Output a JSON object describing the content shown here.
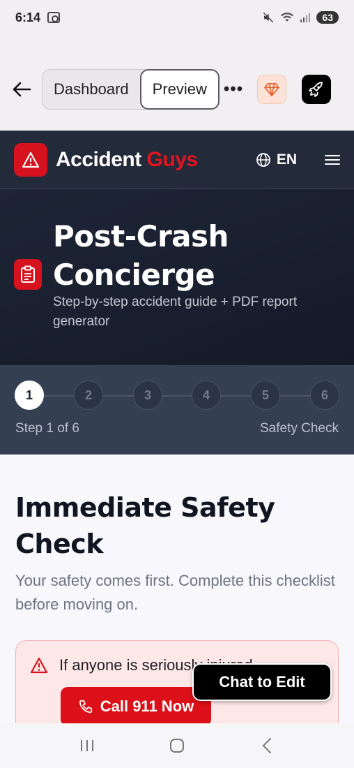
{
  "status_bar": {
    "time": "6:14",
    "battery": "63"
  },
  "browser": {
    "tabs": [
      {
        "label": "Dashboard",
        "active": false
      },
      {
        "label": "Preview",
        "active": true
      }
    ],
    "more_label": "•••"
  },
  "site": {
    "brand_main": "Accident",
    "brand_accent": "Guys",
    "language": "EN"
  },
  "hero": {
    "title": "Post-Crash Concierge",
    "subtitle": "Step-by-step accident guide + PDF report generator"
  },
  "stepper": {
    "steps": [
      "1",
      "2",
      "3",
      "4",
      "5",
      "6"
    ],
    "current": 1,
    "progress_text": "Step 1 of 6",
    "current_label": "Safety Check"
  },
  "section": {
    "title": "Immediate Safety Check",
    "subtitle": "Your safety comes first. Complete this checklist before moving on."
  },
  "alert": {
    "text": "If anyone is seriously injured",
    "button_label": "Call 911 Now"
  },
  "chat_button": "Chat to Edit",
  "colors": {
    "brand_red": "#d5121e",
    "header_bg": "#232a3a",
    "stepper_bg": "#343f52"
  }
}
